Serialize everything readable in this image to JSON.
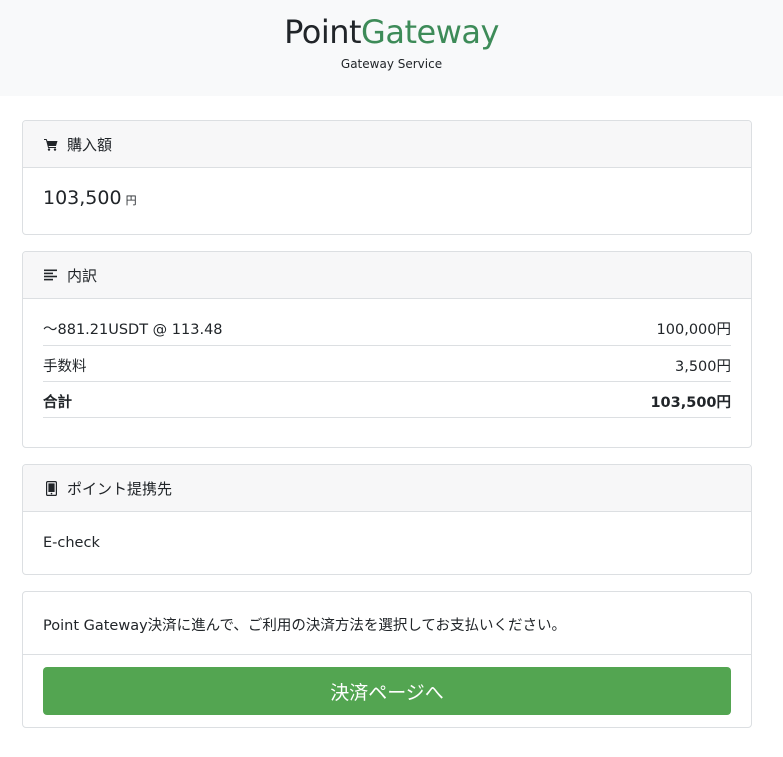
{
  "header": {
    "brand_part1": "Point",
    "brand_part2": "Gateway",
    "tagline": "Gateway Service",
    "brand_accent_color": "#3d8b58"
  },
  "purchase": {
    "title": "購入額",
    "icon": "cart-icon",
    "amount": "103,500",
    "unit": "円"
  },
  "breakdown": {
    "title": "内訳",
    "icon": "list-icon",
    "rows": [
      {
        "label": "〜881.21USDT @ 113.48",
        "value": "100,000円"
      },
      {
        "label": "手数料",
        "value": "3,500円"
      },
      {
        "label": "合計",
        "value": "103,500円"
      }
    ]
  },
  "partner": {
    "title": "ポイント提携先",
    "icon": "tablet-icon",
    "name": "E-check"
  },
  "payment": {
    "message": "Point Gateway決済に進んで、ご利用の決済方法を選択してお支払いください。",
    "button_label": "決済ページへ",
    "button_color": "#53a551"
  }
}
